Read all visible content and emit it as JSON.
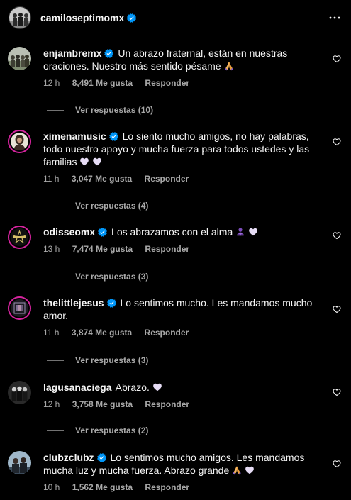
{
  "post": {
    "username": "camiloseptimomx",
    "verified": true
  },
  "comments": [
    {
      "username": "enjambremx",
      "verified": true,
      "text": "Un abrazo fraternal, están en nuestras oraciones. Nuestro más sentido pésame",
      "emojis": [
        "folded-hands"
      ],
      "time": "12 h",
      "likes": "8,491 Me gusta",
      "reply_label": "Responder",
      "view_replies": "Ver respuestas (10)"
    },
    {
      "username": "ximenamusic",
      "verified": true,
      "text": "Lo siento mucho amigos, no hay palabras, todo nuestro apoyo y mucha fuerza para todos ustedes y las familias",
      "emojis": [
        "white-heart",
        "white-heart"
      ],
      "time": "11 h",
      "likes": "3,047 Me gusta",
      "reply_label": "Responder",
      "view_replies": "Ver respuestas (4)"
    },
    {
      "username": "odisseomx",
      "verified": true,
      "text": "Los abrazamos con el alma",
      "emojis": [
        "purple-hug",
        "white-heart"
      ],
      "time": "13 h",
      "likes": "7,474 Me gusta",
      "reply_label": "Responder",
      "view_replies": "Ver respuestas (3)"
    },
    {
      "username": "thelittlejesus",
      "verified": true,
      "text": "Lo sentimos mucho. Les mandamos mucho amor.",
      "emojis": [],
      "time": "11 h",
      "likes": "3,874 Me gusta",
      "reply_label": "Responder",
      "view_replies": "Ver respuestas (3)"
    },
    {
      "username": "lagusanaciega",
      "verified": false,
      "text": "Abrazo.",
      "emojis": [
        "white-heart"
      ],
      "time": "12 h",
      "likes": "3,758 Me gusta",
      "reply_label": "Responder",
      "view_replies": "Ver respuestas (2)"
    },
    {
      "username": "clubzclubz",
      "verified": true,
      "text": "Lo sentimos mucho amigos. Les mandamos mucha luz y mucha fuerza. Abrazo grande",
      "emojis": [
        "folded-hands",
        "white-heart"
      ],
      "time": "10 h",
      "likes": "1,562 Me gusta",
      "reply_label": "Responder"
    }
  ],
  "icons": {
    "more": "more-horizontal-icon",
    "like": "heart-outline-icon",
    "verified": "verified-badge-icon"
  },
  "colors": {
    "background": "#000000",
    "text": "#f5f5f5",
    "secondary_text": "#a8a8a8",
    "verified": "#0095f6",
    "story_ring": "#d6249f"
  }
}
